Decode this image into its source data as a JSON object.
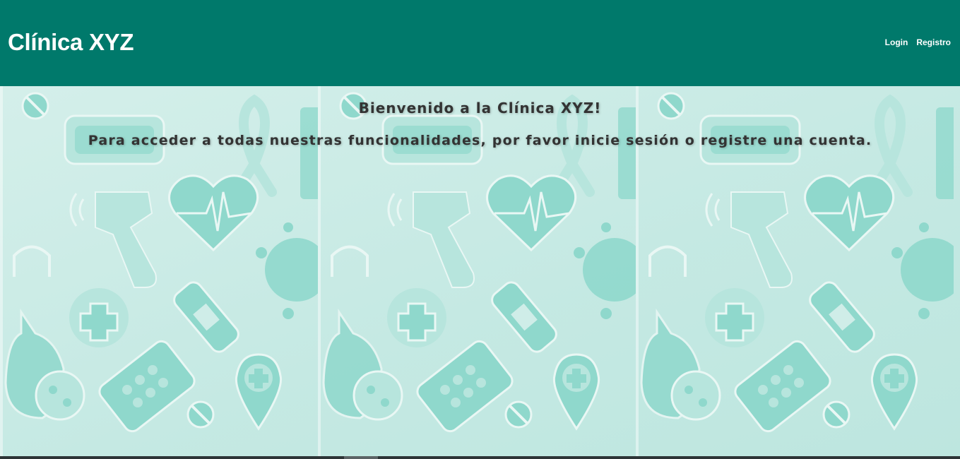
{
  "header": {
    "brand": "Clínica XYZ",
    "nav": [
      {
        "label": "Login"
      },
      {
        "label": "Registro"
      }
    ],
    "color": "#00796b"
  },
  "hero": {
    "title": "Bienvenido a la Clínica XYZ!",
    "subtitle": "Para acceder a todas nuestras funcionalidades, por favor inicie sesión o registre una cuenta.",
    "background_color": "#cbeae6",
    "pattern_color": "#8fd8cc",
    "pattern_icons": [
      "face-mask-icon",
      "awareness-ribbon-icon",
      "thermometer-gun-icon",
      "heartbeat-heart-icon",
      "virus-icon",
      "medical-cross-icon",
      "bandage-icon",
      "lungs-icon",
      "pill-blister-icon",
      "location-pin-cross-icon",
      "pill-icon",
      "bottle-icon"
    ]
  }
}
